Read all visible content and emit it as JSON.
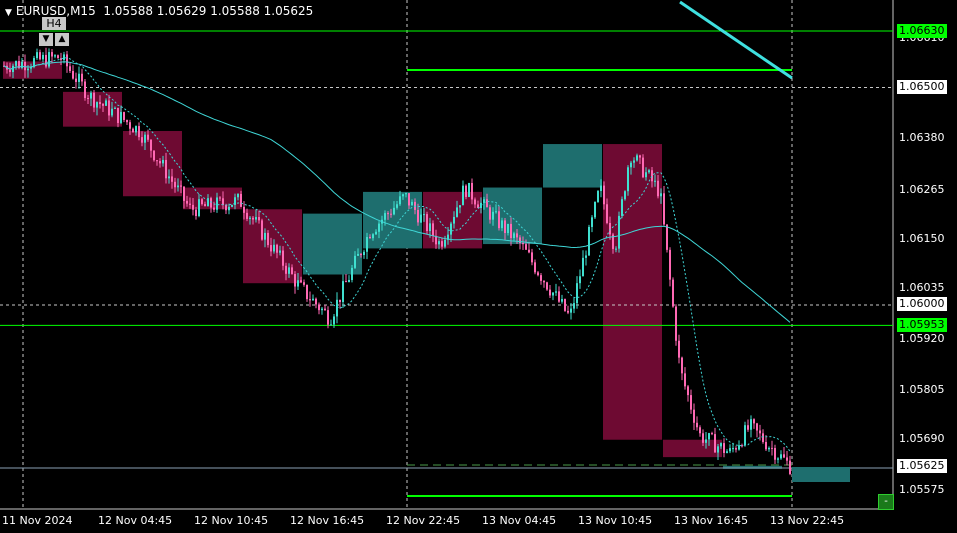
{
  "header": {
    "symbol_timeframe": "EURUSD,M15",
    "ohlc": "1.05588 1.05629 1.05588 1.05625",
    "overlay_timeframe": "H4"
  },
  "price_axis": {
    "ticks": [
      "1.06610",
      "1.06380",
      "1.06265",
      "1.06150",
      "1.06035",
      "1.05920",
      "1.05805",
      "1.05690",
      "1.05575"
    ],
    "labels": {
      "level_high": "1.06630",
      "level_round_high": "1.06500",
      "level_round_low": "1.06000",
      "level_low": "1.05953",
      "current_bid": "1.05625"
    }
  },
  "time_axis": {
    "ticks": [
      "11 Nov 2024",
      "12 Nov 04:45",
      "12 Nov 10:45",
      "12 Nov 16:45",
      "12 Nov 22:45",
      "13 Nov 04:45",
      "13 Nov 10:45",
      "13 Nov 16:45",
      "13 Nov 22:45"
    ]
  },
  "chart_data": {
    "type": "candlestick",
    "symbol": "EURUSD",
    "timeframe": "M15",
    "last_bar": {
      "open": 1.05588,
      "high": 1.05629,
      "low": 1.05588,
      "close": 1.05625
    },
    "ylim": [
      1.0552,
      1.0671
    ],
    "horizontal_levels": [
      1.0663,
      1.065,
      1.06,
      1.05953,
      1.05625
    ],
    "h4_boxes": [
      {
        "open": 1.0656,
        "close": 1.0652,
        "dir": "down"
      },
      {
        "open": 1.0649,
        "close": 1.0641,
        "dir": "down"
      },
      {
        "open": 1.064,
        "close": 1.0625,
        "dir": "down"
      },
      {
        "open": 1.0627,
        "close": 1.0622,
        "dir": "down"
      },
      {
        "open": 1.0622,
        "close": 1.0605,
        "dir": "down"
      },
      {
        "open": 1.0607,
        "close": 1.0621,
        "dir": "up"
      },
      {
        "open": 1.0613,
        "close": 1.0626,
        "dir": "up"
      },
      {
        "open": 1.0626,
        "close": 1.0613,
        "dir": "down"
      },
      {
        "open": 1.0614,
        "close": 1.0627,
        "dir": "up"
      },
      {
        "open": 1.0627,
        "close": 1.0637,
        "dir": "up"
      },
      {
        "open": 1.0637,
        "close": 1.0569,
        "dir": "down"
      },
      {
        "open": 1.0569,
        "close": 1.0565,
        "dir": "down"
      },
      {
        "open": 1.0563,
        "close": 1.0563,
        "dir": "up"
      }
    ],
    "colors": {
      "bull": "#40e0d0",
      "bear": "#ff69b4",
      "bull_box": "#1e6e6e",
      "bear_box": "#6e0a32",
      "ma": "#3fd6d6",
      "levels": "#00ff00"
    }
  },
  "controls": {
    "minus_label": "-",
    "down_arrow": "▼",
    "up_arrow": "▲"
  }
}
